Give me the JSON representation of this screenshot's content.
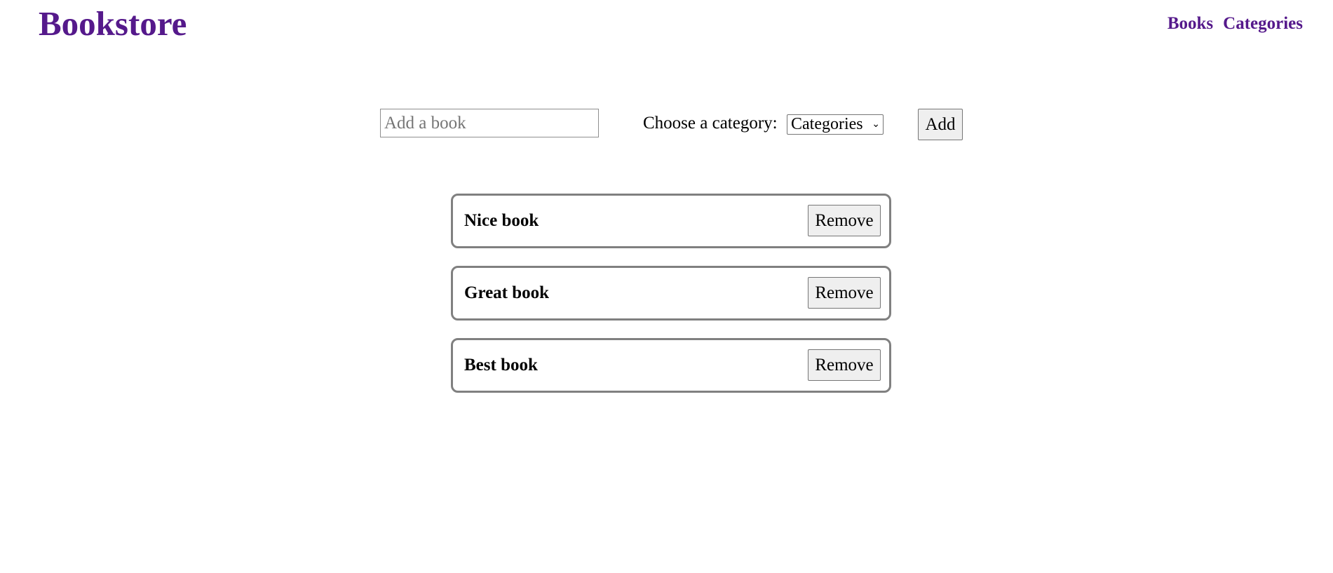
{
  "header": {
    "brand": "Bookstore",
    "nav": [
      {
        "label": "Books"
      },
      {
        "label": "Categories"
      }
    ]
  },
  "form": {
    "input_placeholder": "Add a book",
    "input_value": "",
    "category_label": "Choose a category:",
    "category_selected": "Categories",
    "add_label": "Add"
  },
  "books": [
    {
      "title": "Nice book",
      "remove_label": "Remove"
    },
    {
      "title": "Great book",
      "remove_label": "Remove"
    },
    {
      "title": "Best book",
      "remove_label": "Remove"
    }
  ],
  "colors": {
    "brand": "#55198b",
    "card_border": "#808080",
    "button_bg": "#efefef"
  }
}
